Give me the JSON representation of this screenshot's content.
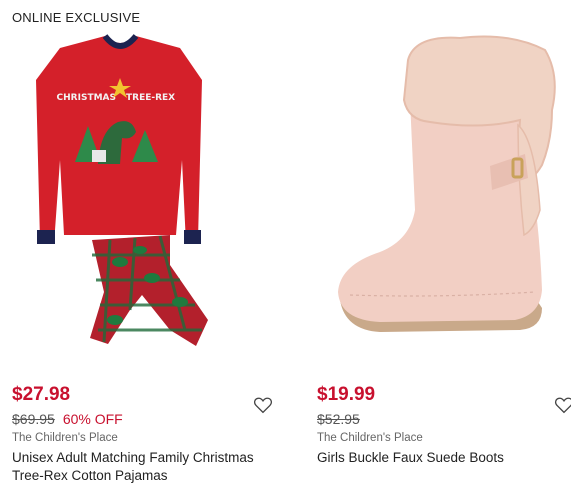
{
  "products": [
    {
      "badge": "ONLINE EXCLUSIVE",
      "image_alt": "heart-icon",
      "price": "$27.98",
      "original_price": "$69.95",
      "discount": "60% OFF",
      "brand": "The Children's Place",
      "title": "Unisex Adult Matching Family Christmas Tree-Rex Cotton Pajamas",
      "shirt_text_left": "CHRISTMAS",
      "shirt_text_right": "TREE-REX"
    },
    {
      "price": "$19.99",
      "original_price": "$52.95",
      "brand": "The Children's Place",
      "title": "Girls Buckle Faux Suede Boots"
    }
  ],
  "colors": {
    "sale_red": "#c8102e",
    "pajama_red": "#d4202a",
    "navy": "#1c2350",
    "plaid_green": "#1f6b3a",
    "boot": "#f2cfc4",
    "fur": "#f0d3c4"
  }
}
